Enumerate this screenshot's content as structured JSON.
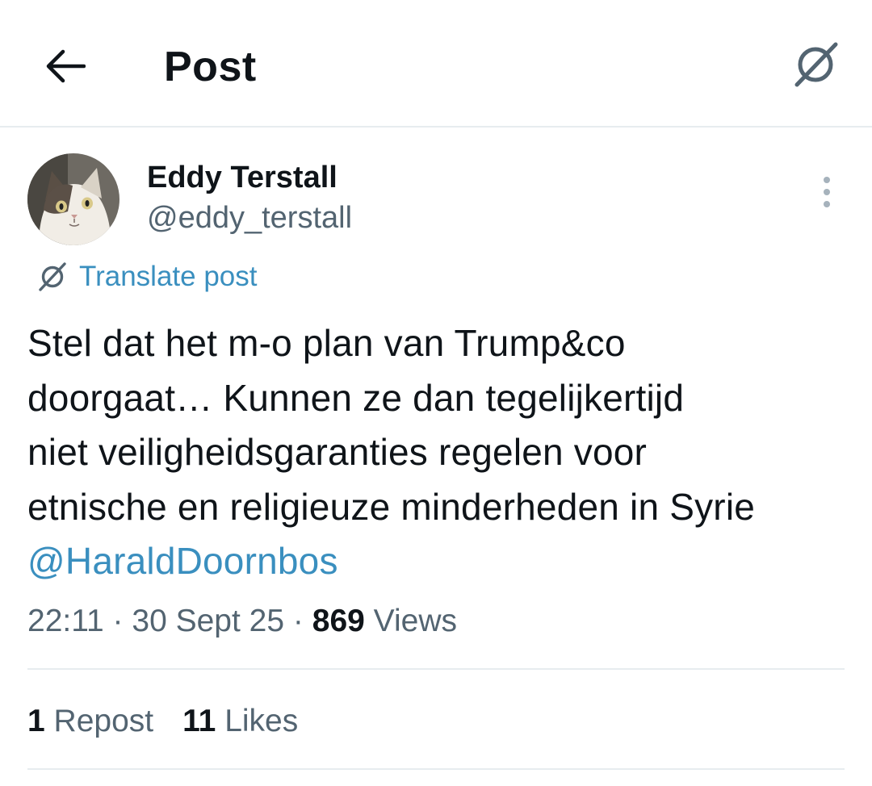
{
  "header": {
    "title": "Post",
    "back_icon": "arrow-left-icon",
    "translate_icon": "translate-icon"
  },
  "author": {
    "name": "Eddy Terstall",
    "handle": "@eddy_terstall",
    "avatar": "cat-avatar"
  },
  "translate": {
    "label": "Translate post"
  },
  "post": {
    "lines": [
      "Stel dat het m-o plan van Trump&co",
      "doorgaat… Kunnen ze dan tegelijkertijd",
      "niet veiligheidsgaranties regelen voor",
      "etnische en religieuze minderheden in Syrie"
    ],
    "mention": "@HaraldDoornbos"
  },
  "meta": {
    "time": "22:11",
    "separator": "·",
    "date": "30 Sept 25",
    "views_count": "869",
    "views_label": "Views"
  },
  "stats": {
    "reposts_count": "1",
    "reposts_label": "Repost",
    "likes_count": "11",
    "likes_label": "Likes"
  },
  "colors": {
    "text": "#0f1419",
    "secondary": "#536471",
    "link": "#3a8fbf",
    "divider": "#e7ecef"
  }
}
